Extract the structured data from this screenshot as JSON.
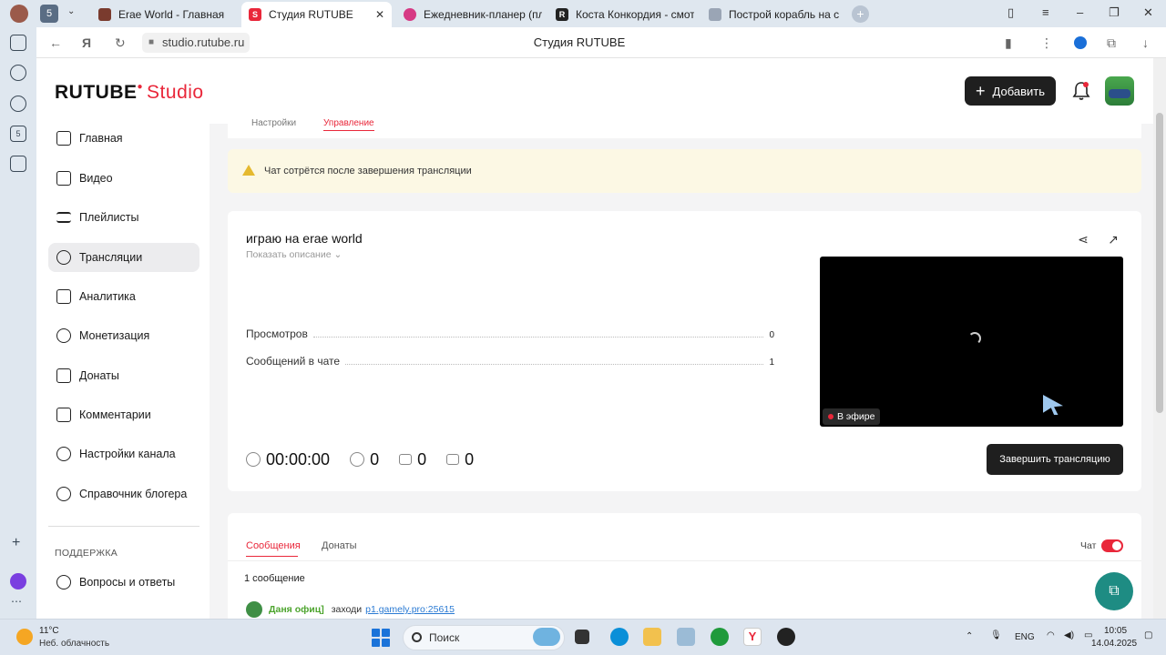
{
  "browser": {
    "tabs": [
      {
        "label": "Erae World - Главная",
        "active": false
      },
      {
        "label": "Студия RUTUBE",
        "active": true
      },
      {
        "label": "Ежедневник-планер (пла",
        "active": false
      },
      {
        "label": "Коста Конкордия - смотр",
        "active": false
      },
      {
        "label": "Построй корабль на с",
        "active": false
      }
    ],
    "tab_counter": "5",
    "url": "studio.rutube.ru",
    "page_title": "Студия RUTUBE"
  },
  "header": {
    "logo_main": "RUTUBE",
    "logo_suffix": "Studio",
    "add_button": "Добавить"
  },
  "sidebar": {
    "items": [
      {
        "label": "Главная",
        "icon": "home-icon"
      },
      {
        "label": "Видео",
        "icon": "video-icon"
      },
      {
        "label": "Плейлисты",
        "icon": "playlist-icon"
      },
      {
        "label": "Трансляции",
        "icon": "broadcast-icon"
      },
      {
        "label": "Аналитика",
        "icon": "analytics-icon"
      },
      {
        "label": "Монетизация",
        "icon": "ruble-icon"
      },
      {
        "label": "Донаты",
        "icon": "wallet-icon"
      },
      {
        "label": "Комментарии",
        "icon": "comment-icon"
      },
      {
        "label": "Настройки канала",
        "icon": "gear-icon"
      },
      {
        "label": "Справочник блогера",
        "icon": "info-icon"
      }
    ],
    "support_heading": "ПОДДЕРЖКА",
    "support_items": [
      {
        "label": "Вопросы и ответы",
        "icon": "question-icon"
      }
    ]
  },
  "main": {
    "top_tabs": [
      "Настройки",
      "Управление"
    ],
    "notice": "Чат сотрётся после завершения трансляции",
    "stream": {
      "title": "играю на erae world",
      "show_description": "Показать описание",
      "stats": [
        {
          "label": "Просмотров",
          "value": "0"
        },
        {
          "label": "Сообщений в чате",
          "value": "1"
        }
      ],
      "live_badge": "В эфире",
      "timer": "00:00:00",
      "viewers": "0",
      "likes": "0",
      "dislikes": "0",
      "end_button": "Завершить трансляцию"
    },
    "chat": {
      "tabs": [
        "Сообщения",
        "Донаты"
      ],
      "toggle_label": "Чат",
      "message_count": "1 сообщение",
      "messages": [
        {
          "author": "Даня офиц]",
          "text": "заходи",
          "link": "p1.gamely.pro:25615"
        }
      ]
    }
  },
  "taskbar": {
    "temperature": "11°C",
    "weather": "Неб. облачность",
    "search": "Поиск",
    "lang": "ENG",
    "time": "10:05",
    "date": "14.04.2025"
  },
  "colors": {
    "accent": "#e9273a",
    "dark_button": "#1f1f1f",
    "notice_bg": "#fcf8e4",
    "chat_author": "#4ea52f"
  }
}
